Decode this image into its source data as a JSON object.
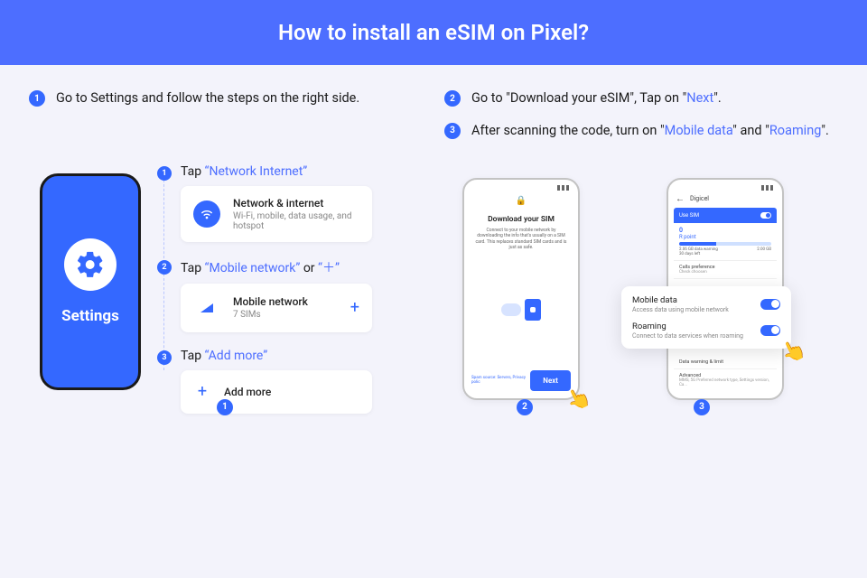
{
  "hero": {
    "title": "How to install an eSIM on Pixel?"
  },
  "instructions": {
    "i1": {
      "n": "1",
      "text": "Go to Settings and follow the steps on the right side."
    },
    "i2": {
      "n": "2",
      "pre": "Go to \"Download your eSIM\", Tap on \"",
      "link": "Next",
      "post": "\"."
    },
    "i3": {
      "n": "3",
      "pre": "After scanning the code, turn on \"",
      "link1": "Mobile data",
      "mid": "\" and \"",
      "link2": "Roaming",
      "post": "\"."
    }
  },
  "panel1": {
    "settings_label": "Settings",
    "step1": {
      "n": "1",
      "pre": "Tap ",
      "link": "“Network Internet”",
      "card_title": "Network & internet",
      "card_sub": "Wi-Fi, mobile, data usage, and hotspot"
    },
    "step2": {
      "n": "2",
      "pre": "Tap ",
      "link": "“Mobile network”",
      "mid": " or ",
      "link2": "“＋”",
      "card_title": "Mobile network",
      "card_sub": "7 SIMs",
      "plus": "+"
    },
    "step3": {
      "n": "3",
      "pre": "Tap ",
      "link": "“Add more”",
      "add_plus": "+",
      "card_title": "Add more"
    },
    "footer_badge": "1"
  },
  "panel2": {
    "phone2_badge": "2",
    "phone3_badge": "3",
    "download": {
      "title": "Download your SIM",
      "desc": "Connect to your mobile network by downloading the info that's usually on a SIM card. This replaces standard SIM cards and is just as safe.",
      "links": "Spam source: Servers, Privacy polic",
      "next": "Next"
    },
    "p3": {
      "carrier_header": "Digicel",
      "use_sim": "Use SIM",
      "carrier": "R point",
      "data_cap_left": "2.06 GB data warning",
      "data_cap_sub": "30 days left",
      "data_cap_right": "2.00 GB",
      "row_calls_t": "Calls preference",
      "row_calls_s": "Check choosen",
      "row_warn": "Data warning & limit",
      "row_adv_t": "Advanced",
      "row_adv_s": "MMS, 5G Preferred network type, Settings version, Ca..."
    },
    "callout": {
      "r1_t": "Mobile data",
      "r1_s": "Access data using mobile network",
      "r2_t": "Roaming",
      "r2_s": "Connect to data services when roaming"
    }
  }
}
